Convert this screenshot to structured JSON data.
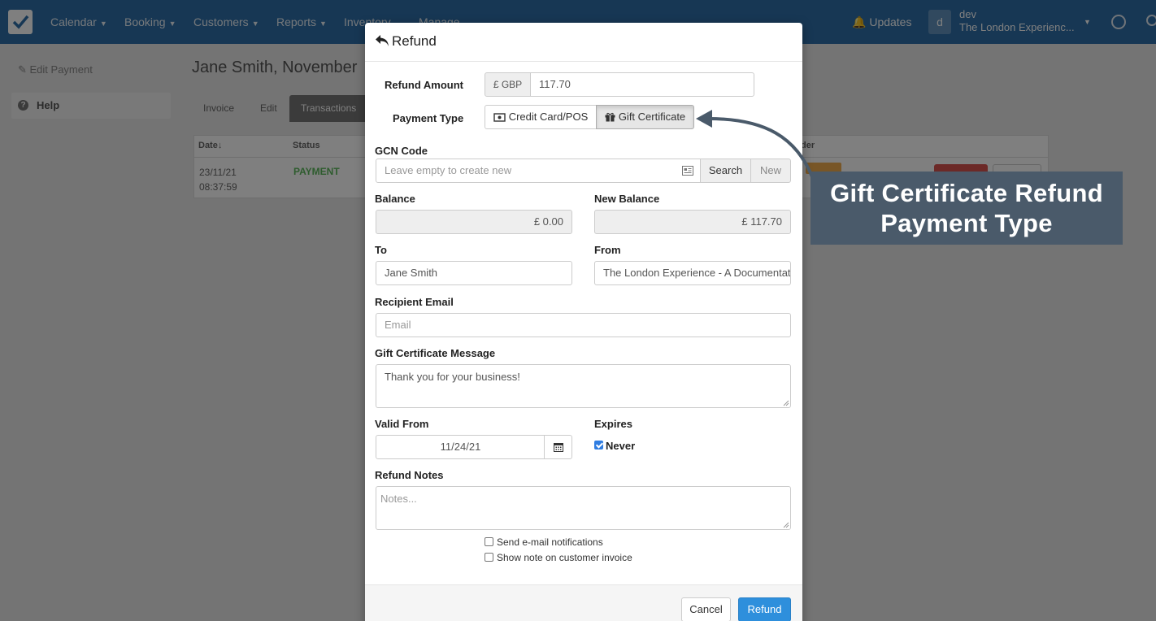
{
  "navbar": {
    "items": [
      {
        "label": "Calendar"
      },
      {
        "label": "Booking"
      },
      {
        "label": "Customers"
      },
      {
        "label": "Reports"
      },
      {
        "label": "Inventory"
      },
      {
        "label": "Manage"
      }
    ],
    "updates_label": "Updates",
    "avatar_initial": "d",
    "user_name": "dev",
    "company_name": "The London Experienc..."
  },
  "sidebar": {
    "back_label": "Edit Payment",
    "help_label": "Help"
  },
  "page": {
    "title": "Jane Smith, November",
    "tabs": [
      {
        "label": "Invoice"
      },
      {
        "label": "Edit"
      },
      {
        "label": "Transactions"
      }
    ],
    "table": {
      "headers": [
        "Date↓",
        "Status",
        "der"
      ],
      "row": {
        "date": "23/11/21",
        "time": "08:37:59",
        "status": "PAYMENT"
      }
    }
  },
  "modal": {
    "title": "Refund",
    "refund_amount_label": "Refund Amount",
    "currency_addon": "£ GBP",
    "refund_amount_value": "117.70",
    "payment_type_label": "Payment Type",
    "payment_types": [
      {
        "label": "Credit Card/POS",
        "active": false
      },
      {
        "label": "Gift Certificate",
        "active": true
      }
    ],
    "gcn_label": "GCN Code",
    "gcn_placeholder": "Leave empty to create new",
    "search_button": "Search",
    "new_button": "New",
    "balance_label": "Balance",
    "balance_value": "£ 0.00",
    "new_balance_label": "New Balance",
    "new_balance_value": "£ 117.70",
    "to_label": "To",
    "to_value": "Jane Smith",
    "from_label": "From",
    "from_value": "The London Experience - A Documentat",
    "recipient_email_label": "Recipient Email",
    "recipient_email_placeholder": "Email",
    "message_label": "Gift Certificate Message",
    "message_value": "Thank you for your business!",
    "valid_from_label": "Valid From",
    "valid_from_value": "11/24/21",
    "expires_label": "Expires",
    "never_label": "Never",
    "never_checked": true,
    "refund_notes_label": "Refund Notes",
    "refund_notes_placeholder": "Notes...",
    "send_email_label": "Send e-mail notifications",
    "send_email_checked": false,
    "show_note_label": "Show note on customer invoice",
    "show_note_checked": false,
    "cancel_button": "Cancel",
    "refund_button": "Refund"
  },
  "callout": {
    "line1": "Gift Certificate Refund",
    "line2": "Payment Type"
  },
  "colors": {
    "navbar": "#2f6fa8",
    "primary": "#2e8fdc",
    "callout": "#4a5a6a",
    "payment_status": "#5cb85c"
  },
  "icons": {
    "refund": "reply-arrow-icon",
    "credit_card": "money-icon",
    "gift": "gift-icon",
    "gcn": "card-reader-icon",
    "calendar": "calendar-icon"
  }
}
